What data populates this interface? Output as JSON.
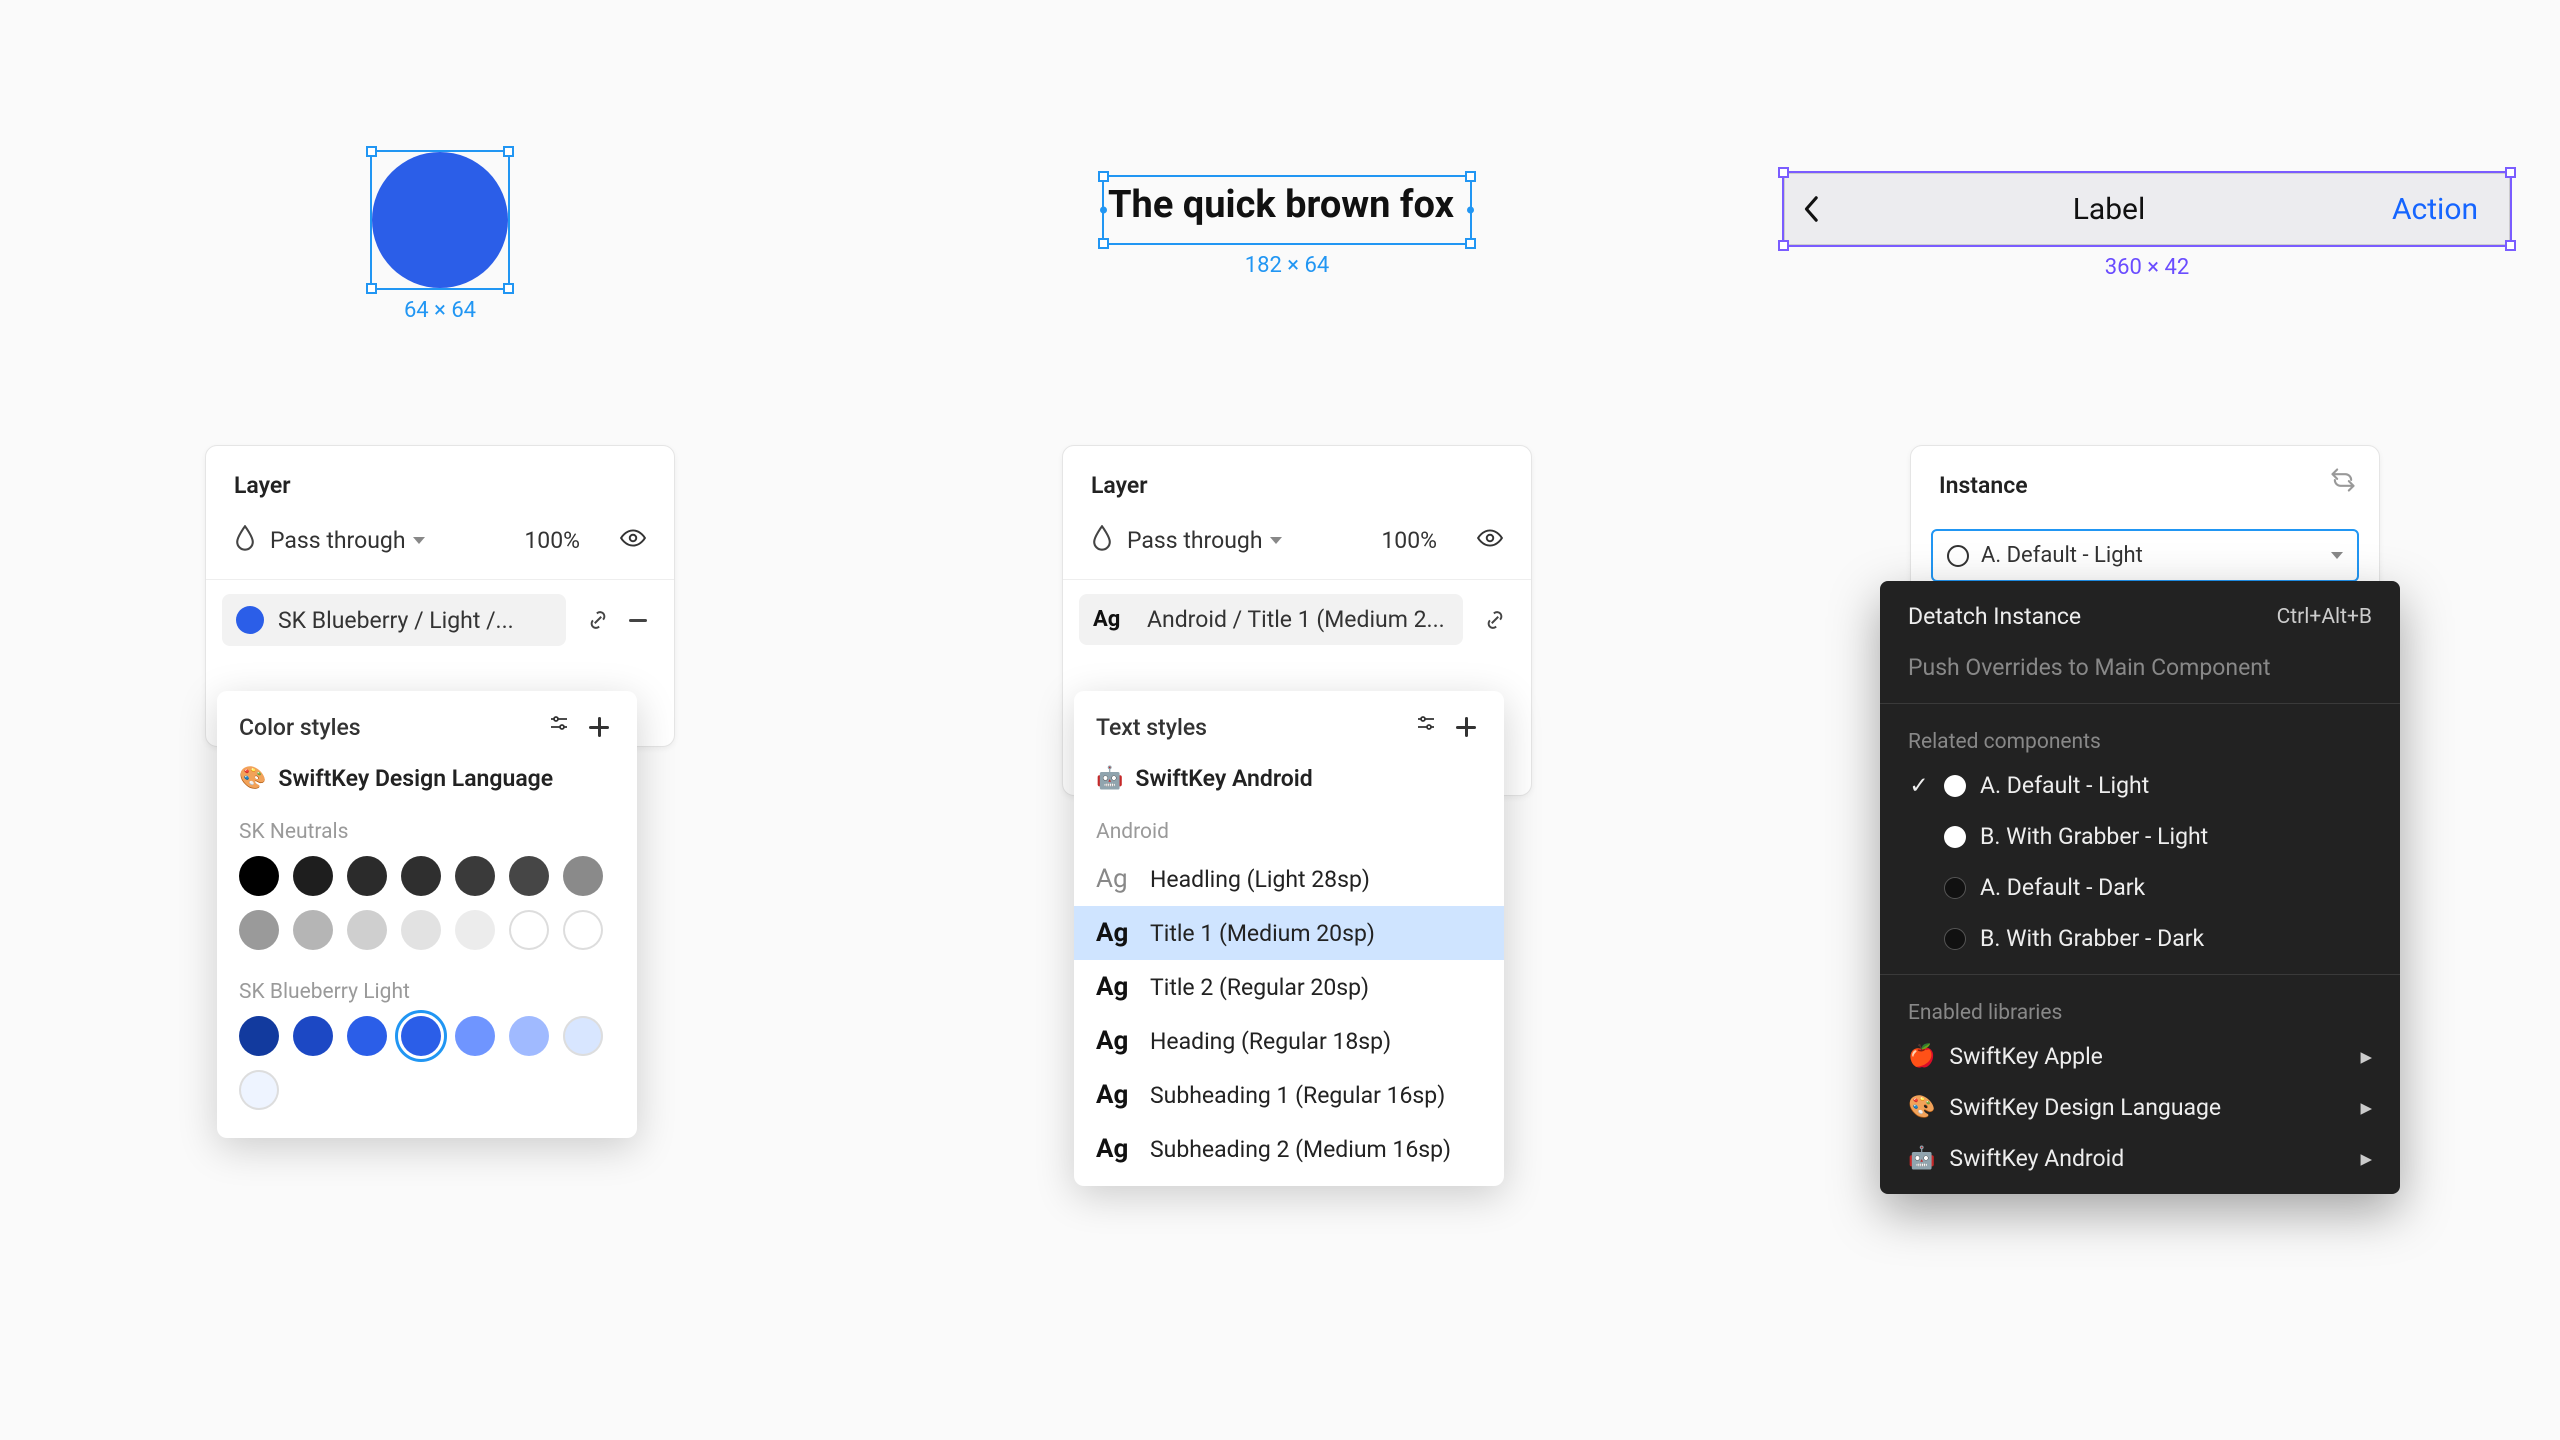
{
  "col1": {
    "selection_dim": "64 × 64",
    "panel_title": "Layer",
    "blend_mode": "Pass through",
    "opacity": "100%",
    "fill_chip": "SK Blueberry / Light /...",
    "popover": {
      "title": "Color styles",
      "library": "SwiftKey Design Language",
      "group1_label": "SK Neutrals",
      "group1_colors": [
        "#000000",
        "#1e1e1e",
        "#2b2b2b",
        "#2f2f2f",
        "#3a3a3a",
        "#464646",
        "#8a8a8a",
        "#9a9a9a",
        "#b5b5b5",
        "#cfcfcf",
        "#e2e2e2",
        "#ececec",
        "#ffffff",
        "#ffffff"
      ],
      "group2_label": "SK Blueberry Light",
      "group2_colors": [
        "#123a9e",
        "#1c48c4",
        "#2b5ee8",
        "#2b5ee8",
        "#6f95ff",
        "#a0baff",
        "#d8e6ff",
        "#eef4ff"
      ],
      "group2_selected_index": 3
    }
  },
  "col2": {
    "sample_text": "The quick brown fox",
    "selection_dim": "182 × 64",
    "panel_title": "Layer",
    "blend_mode": "Pass through",
    "opacity": "100%",
    "fill_chip": "Android / Title 1 (Medium 2...",
    "popover": {
      "title": "Text styles",
      "library": "SwiftKey Android",
      "group_label": "Android",
      "items": [
        "Headling (Light 28sp)",
        "Title 1 (Medium 20sp)",
        "Title 2 (Regular 20sp)",
        "Heading (Regular 18sp)",
        "Subheading 1 (Regular 16sp)",
        "Subheading 2 (Medium 16sp)"
      ],
      "selected_index": 1
    }
  },
  "col3": {
    "comp_label": "Label",
    "comp_action": "Action",
    "selection_dim": "360 × 42",
    "panel_title": "Instance",
    "instance_selected": "A. Default - Light",
    "menu": {
      "detach": "Detatch Instance",
      "detach_shortcut": "Ctrl+Alt+B",
      "push": "Push Overrides to Main Component",
      "related_label": "Related components",
      "related": [
        {
          "label": "A. Default - Light",
          "variant": "light",
          "checked": true
        },
        {
          "label": "B. With Grabber - Light",
          "variant": "light",
          "checked": false
        },
        {
          "label": "A. Default - Dark",
          "variant": "dark",
          "checked": false
        },
        {
          "label": "B. With Grabber - Dark",
          "variant": "dark",
          "checked": false
        }
      ],
      "enabled_label": "Enabled libraries",
      "libraries": [
        {
          "emoji": "🍎",
          "name": "SwiftKey Apple"
        },
        {
          "emoji": "🎨",
          "name": "SwiftKey Design Language"
        },
        {
          "emoji": "🤖",
          "name": "SwiftKey Android"
        }
      ]
    }
  }
}
